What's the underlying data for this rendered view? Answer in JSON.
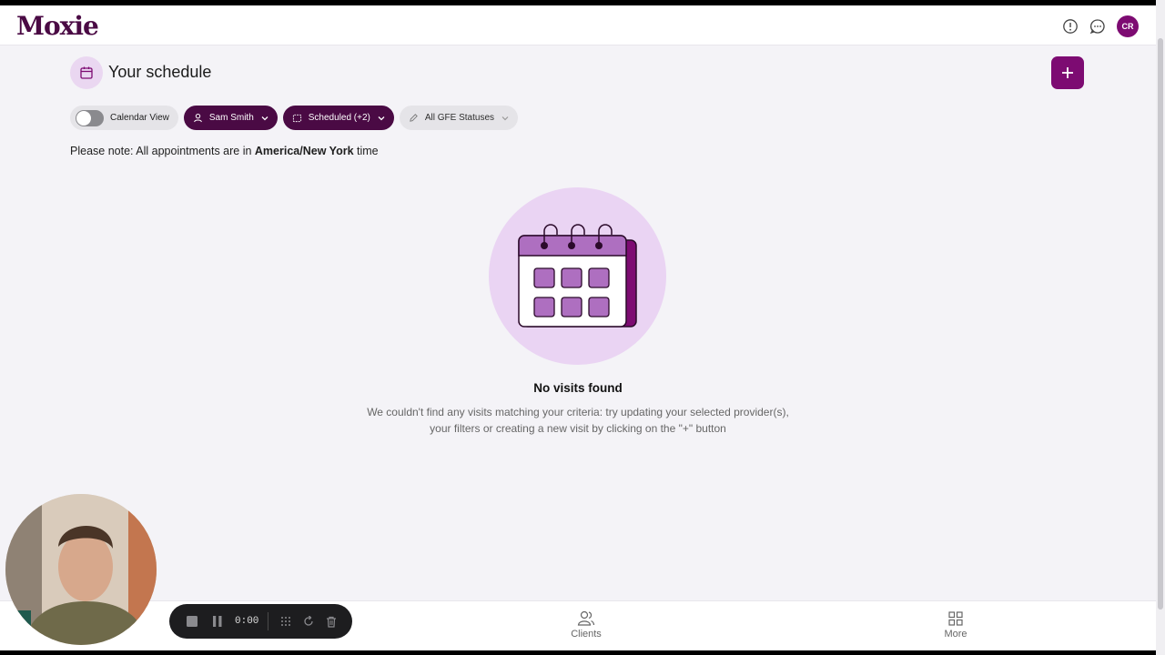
{
  "app": {
    "logo": "Moxie",
    "avatar_initials": "CR"
  },
  "page": {
    "title": "Your schedule"
  },
  "filters": {
    "calendar_view_label": "Calendar View",
    "provider_label": "Sam Smith",
    "status_label": "Scheduled (+2)",
    "gfe_label": "All GFE Statuses"
  },
  "note": {
    "prefix": "Please note: All appointments are in ",
    "timezone": "America/New York",
    "suffix": " time"
  },
  "empty_state": {
    "title": "No visits found",
    "line1": "We couldn't find any visits matching your criteria: try updating your selected provider(s),",
    "line2": "your filters or creating a new visit by clicking on the \"+\" button"
  },
  "bottom_nav": {
    "clients_label": "Clients",
    "more_label": "More"
  },
  "recorder": {
    "time": "0:00"
  },
  "colors": {
    "brand": "#7d0b72",
    "brand_dark": "#4a0a44",
    "accent_light": "#ead4f3"
  }
}
